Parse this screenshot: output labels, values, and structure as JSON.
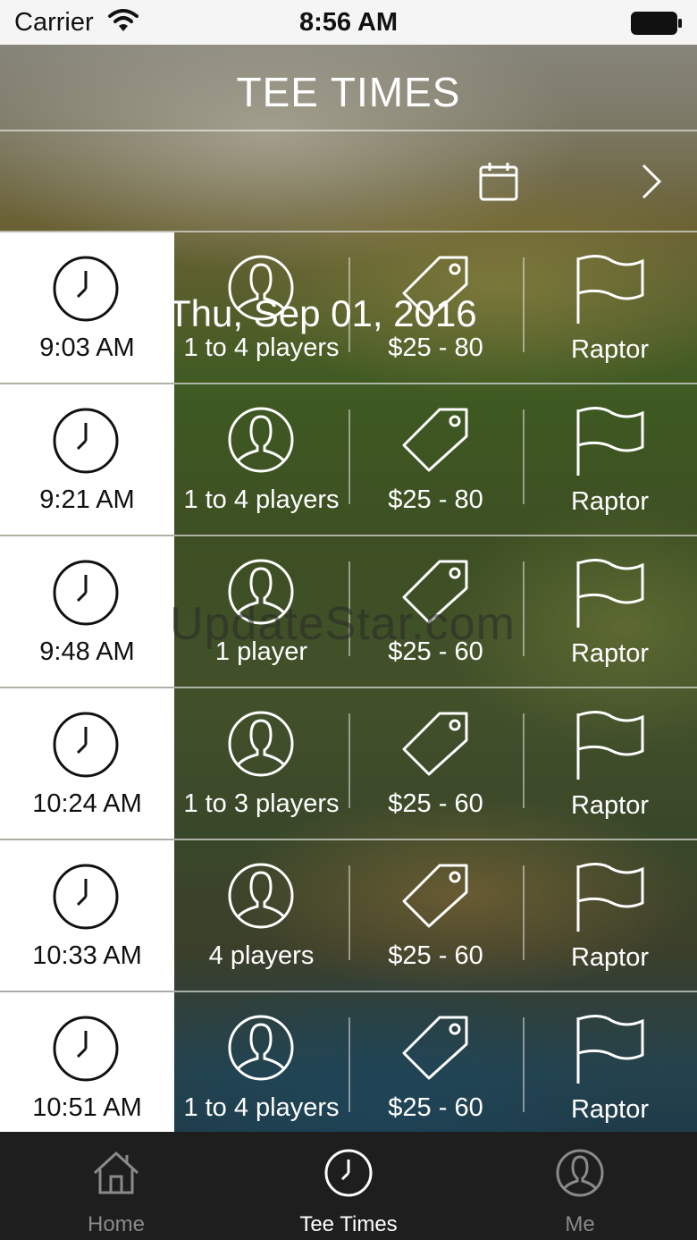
{
  "status_bar": {
    "carrier": "Carrier",
    "time": "8:56 AM",
    "icons": [
      "wifi-icon",
      "battery-icon"
    ]
  },
  "header": {
    "title": "TEE TIMES"
  },
  "date_bar": {
    "date": "Thu, Sep 01, 2016",
    "icons": [
      "calendar-icon",
      "chevron-right-icon"
    ]
  },
  "tee_times": [
    {
      "time": "9:03 AM",
      "players": "1 to 4 players",
      "price": "$25 - 80",
      "course": "Raptor"
    },
    {
      "time": "9:21 AM",
      "players": "1 to 4 players",
      "price": "$25 - 80",
      "course": "Raptor"
    },
    {
      "time": "9:48 AM",
      "players": "1 player",
      "price": "$25 - 60",
      "course": "Raptor"
    },
    {
      "time": "10:24 AM",
      "players": "1 to 3 players",
      "price": "$25 - 60",
      "course": "Raptor"
    },
    {
      "time": "10:33 AM",
      "players": "4 players",
      "price": "$25 - 60",
      "course": "Raptor"
    },
    {
      "time": "10:51 AM",
      "players": "1 to 4 players",
      "price": "$25 - 60",
      "course": "Raptor"
    }
  ],
  "row_icons": [
    "clock-icon",
    "person-icon",
    "price-tag-icon",
    "flag-icon"
  ],
  "watermark": "UpdateStar.com",
  "tab_bar": {
    "tabs": [
      {
        "label": "Home",
        "icon": "home-icon",
        "active": false
      },
      {
        "label": "Tee Times",
        "icon": "clock-icon",
        "active": true
      },
      {
        "label": "Me",
        "icon": "person-icon",
        "active": false
      }
    ]
  },
  "colors": {
    "time_cell_bg": "#ffffff",
    "tab_bar_bg": "#1e1e1e",
    "tab_active": "#ffffff",
    "tab_inactive": "#8a8a8a"
  }
}
